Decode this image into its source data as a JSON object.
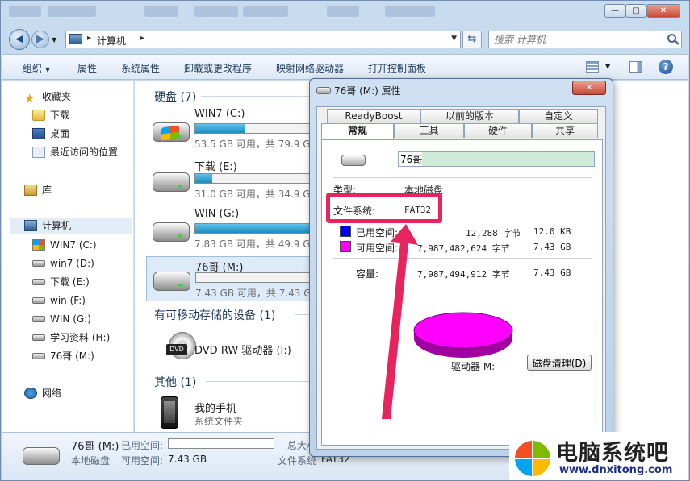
{
  "window": {
    "minimize": "—",
    "maximize": "□",
    "close": "✕"
  },
  "address": {
    "path": "计算机",
    "search_placeholder": "搜索 计算机"
  },
  "toolbar": {
    "organize": "组织",
    "properties": "属性",
    "system_properties": "系统属性",
    "uninstall": "卸载或更改程序",
    "map_drive": "映射网络驱动器",
    "control_panel": "打开控制面板",
    "help": "?"
  },
  "sidebar": {
    "favorites": "收藏夹",
    "downloads": "下载",
    "desktop": "桌面",
    "recent": "最近访问的位置",
    "libraries": "库",
    "computer": "计算机",
    "drives": [
      "WIN7 (C:)",
      "win7 (D:)",
      "下载 (E:)",
      "win (F:)",
      "WIN (G:)",
      "学习资料 (H:)",
      "76哥 (M:)"
    ],
    "network": "网络"
  },
  "content": {
    "hard_disks_header": "硬盘 (7)",
    "drives": [
      {
        "name": "WIN7 (C:)",
        "info": "53.5 GB 可用，共 79.9 GB",
        "fill": 0.33
      },
      {
        "name": "下载 (E:)",
        "info": "31.0 GB 可用，共 34.9 GB",
        "fill": 0.11
      },
      {
        "name": "WIN (G:)",
        "info": "7.83 GB 可用，共 49.9 GB",
        "fill": 0.84
      },
      {
        "name": "76哥 (M:)",
        "info": "7.43 GB 可用，共 7.43 GB",
        "fill": 0.0
      }
    ],
    "removable_header": "有可移动存储的设备 (1)",
    "dvd_name": "DVD RW 驱动器 (I:)",
    "dvd_badge": "DVD",
    "other_header": "其他 (1)",
    "phone_name": "我的手机",
    "phone_type": "系统文件夹"
  },
  "details": {
    "name": "76哥 (M:)",
    "type": "本地磁盘",
    "used_label": "已用空间:",
    "free_label": "可用空间:",
    "free_value": "7.43 GB",
    "total_label": "总大小",
    "fs_label": "文件系统",
    "fs_value": "FAT32"
  },
  "dialog": {
    "title": "76哥 (M:) 属性",
    "close": "✕",
    "tabs_row1": [
      "ReadyBoost",
      "以前的版本",
      "自定义"
    ],
    "tabs_row2": [
      "常规",
      "工具",
      "硬件",
      "共享"
    ],
    "label_value": "76哥",
    "type_label": "类型:",
    "type_value": "本地磁盘",
    "fs_label": "文件系统:",
    "fs_value": "FAT32",
    "used_label": "已用空间:",
    "used_bytes": "12,288 字节",
    "used_size": "12.0 KB",
    "free_label": "可用空间:",
    "free_bytes": "7,987,482,624 字节",
    "free_size": "7.43 GB",
    "capacity_label": "容量:",
    "capacity_bytes": "7,987,494,912 字节",
    "capacity_size": "7.43 GB",
    "drive_label": "驱动器 M:",
    "cleanup_button": "磁盘清理(D)",
    "used_color": "#0000ff",
    "free_color": "#ff00ff"
  },
  "watermark": {
    "title": "电脑系统吧",
    "url": "www.dnxitong.com"
  }
}
